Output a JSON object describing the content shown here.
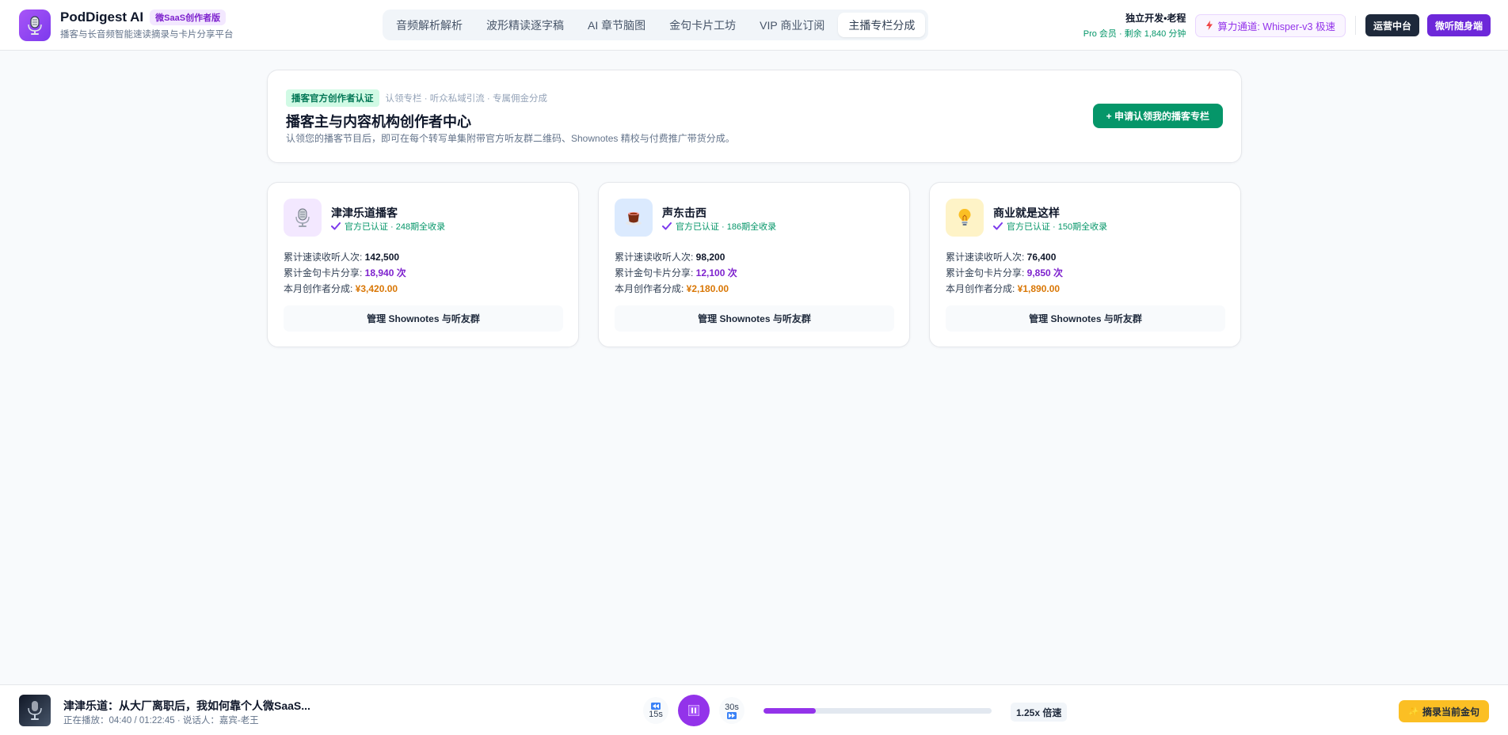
{
  "app": {
    "name": "PodDigest AI",
    "badge": "微SaaS创作者版",
    "subtitle": "播客与长音频智能速读摘录与卡片分享平台"
  },
  "nav": {
    "tabs": [
      {
        "label": "音频解析解析",
        "active": false
      },
      {
        "label": "波形精读逐字稿",
        "active": false
      },
      {
        "label": "AI 章节脑图",
        "active": false
      },
      {
        "label": "金句卡片工坊",
        "active": false
      },
      {
        "label": "VIP 商业订阅",
        "active": false
      },
      {
        "label": "主播专栏分成",
        "active": true
      }
    ]
  },
  "user": {
    "name": "独立开发•老程",
    "meta": "Pro 会员 · 剩余 1,840 分钟",
    "engine": "算力通道: Whisper-v3 极速",
    "ops_label": "运营中台",
    "mobile_label": "微听随身端"
  },
  "hero": {
    "tag": "播客官方创作者认证",
    "tag_sub": "认领专栏 · 听众私域引流 · 专属佣金分成",
    "title": "播客主与内容机构创作者中心",
    "desc": "认领您的播客节目后，即可在每个转写单集附带官方听友群二维码、Shownotes 精校与付费推广带货分成。",
    "apply_label": "+ 申请认领我的播客专栏"
  },
  "stat_labels": {
    "listeners": "累计速读收听人次: ",
    "shares": "累计金句卡片分享: ",
    "revenue": "本月创作者分成: "
  },
  "cards": [
    {
      "name": "津津乐道播客",
      "verify": "官方已认证 · 248期全收录",
      "listeners": "142,500",
      "shares": "18,940 次",
      "revenue": "¥3,420.00",
      "button": "管理 Shownotes 与听友群",
      "icon": "microphone-icon",
      "icon_bg": "#f3e8ff"
    },
    {
      "name": "声东击西",
      "verify": "官方已认证 · 186期全收录",
      "listeners": "98,200",
      "shares": "12,100 次",
      "revenue": "¥2,180.00",
      "button": "管理 Shownotes 与听友群",
      "icon": "coffee-icon",
      "icon_bg": "#dbeafe"
    },
    {
      "name": "商业就是这样",
      "verify": "官方已认证 · 150期全收录",
      "listeners": "76,400",
      "shares": "9,850 次",
      "revenue": "¥1,890.00",
      "button": "管理 Shownotes 与听友群",
      "icon": "lightbulb-icon",
      "icon_bg": "#fef3c7"
    }
  ],
  "player": {
    "title": "津津乐道：从大厂离职后，我如何靠个人微SaaS...",
    "meta": "正在播放：04:40 / 01:22:45 · 说话人：嘉宾-老王",
    "rewind_label": "15s",
    "forward_label": "30s",
    "progress": 0.23,
    "speed": "1.25x 倍速",
    "capture_label": "摘录当前金句"
  },
  "colors": {
    "accent": "#9333ea",
    "success": "#059669",
    "revenue": "#d97706"
  }
}
